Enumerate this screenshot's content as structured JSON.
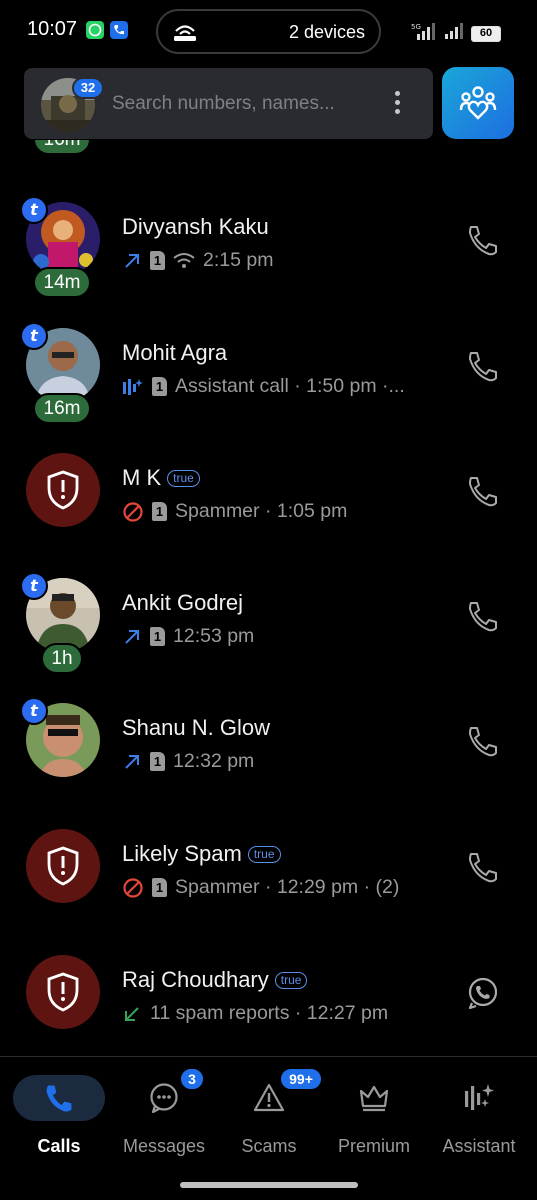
{
  "status_bar": {
    "time": "10:07",
    "island_text": "2 devices",
    "network": "5G",
    "battery": "60"
  },
  "search": {
    "placeholder": "Search numbers, names...",
    "badge_count": "32"
  },
  "partial_row": {
    "duration": "16m"
  },
  "calls": [
    {
      "name": "Divyansh Kaku",
      "detail": "2:15 pm",
      "duration": "14m",
      "type": "outgoing",
      "wifi": true,
      "sim": "1",
      "action": "call"
    },
    {
      "name": "Mohit Agra",
      "detail": "Assistant call · 1:50 pm ·...",
      "duration": "16m",
      "type": "assistant",
      "sim": "1",
      "action": "call"
    },
    {
      "name": "M K",
      "detail": "Spammer · 1:05 pm",
      "tag": "true",
      "type": "blocked",
      "sim": "1",
      "action": "call"
    },
    {
      "name": "Ankit Godrej",
      "detail": "12:53 pm",
      "duration": "1h",
      "type": "outgoing",
      "sim": "1",
      "action": "call"
    },
    {
      "name": "Shanu N. Glow",
      "detail": "12:32 pm",
      "type": "outgoing",
      "sim": "1",
      "action": "call"
    },
    {
      "name": "Likely Spam",
      "detail": "Spammer · 12:29 pm · (2)",
      "tag": "true",
      "type": "blocked",
      "sim": "1",
      "action": "call"
    },
    {
      "name": "Raj Choudhary",
      "detail": "11 spam reports · 12:27 pm",
      "tag": "true",
      "type": "incoming",
      "action": "whatsapp"
    }
  ],
  "bottom_nav": {
    "items": [
      {
        "label": "Calls",
        "icon": "phone-icon",
        "active": true
      },
      {
        "label": "Messages",
        "icon": "chat-icon",
        "badge": "3"
      },
      {
        "label": "Scams",
        "icon": "warning-icon",
        "badge": "99+"
      },
      {
        "label": "Premium",
        "icon": "crown-icon"
      },
      {
        "label": "Assistant",
        "icon": "assistant-icon"
      }
    ]
  },
  "colors": {
    "accent": "#1f6fea",
    "spam_bg": "#5e1512",
    "duration_bg": "#2e6b3b",
    "outgoing": "#3d7fe8",
    "blocked": "#e5463a",
    "incoming": "#3aa25a"
  }
}
